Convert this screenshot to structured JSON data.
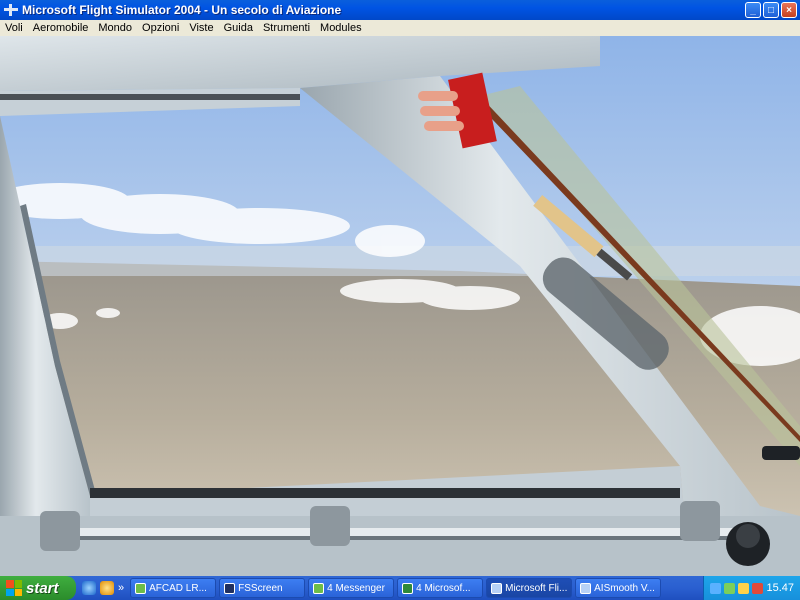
{
  "window": {
    "title": "Microsoft Flight Simulator 2004 - Un secolo di Aviazione",
    "icon": "airplane-icon",
    "controls": [
      "minimize-icon",
      "maximize-icon",
      "close-icon"
    ]
  },
  "menu": [
    "Voli",
    "Aeromobile",
    "Mondo",
    "Opzioni",
    "Viste",
    "Guida",
    "Strumenti",
    "Modules"
  ],
  "scene": {
    "description_icon": "cockpit-window-view",
    "colors": {
      "sky": "#c7d8ee",
      "ground": "#b7ae9d",
      "frame": "#c9d3da",
      "panel_red": "#c81e1e"
    }
  },
  "taskbar": {
    "start_label": "start",
    "quicklaunch_icons": [
      "internet-explorer-icon",
      "messenger-icon"
    ],
    "quicklaunch_more": "»",
    "tasks": [
      {
        "label": "AFCAD   LR...",
        "icon": "afcad-icon"
      },
      {
        "label": "FSScreen",
        "icon": "fsscreen-icon"
      },
      {
        "label": "4 Messenger",
        "icon": "messenger-icon"
      },
      {
        "label": "4 Microsof...",
        "icon": "excel-icon"
      },
      {
        "label": "Microsoft Fli...",
        "icon": "flight-sim-icon",
        "active": true
      },
      {
        "label": "AISmooth V...",
        "icon": "aismooth-icon"
      }
    ],
    "clock": "15.47"
  }
}
